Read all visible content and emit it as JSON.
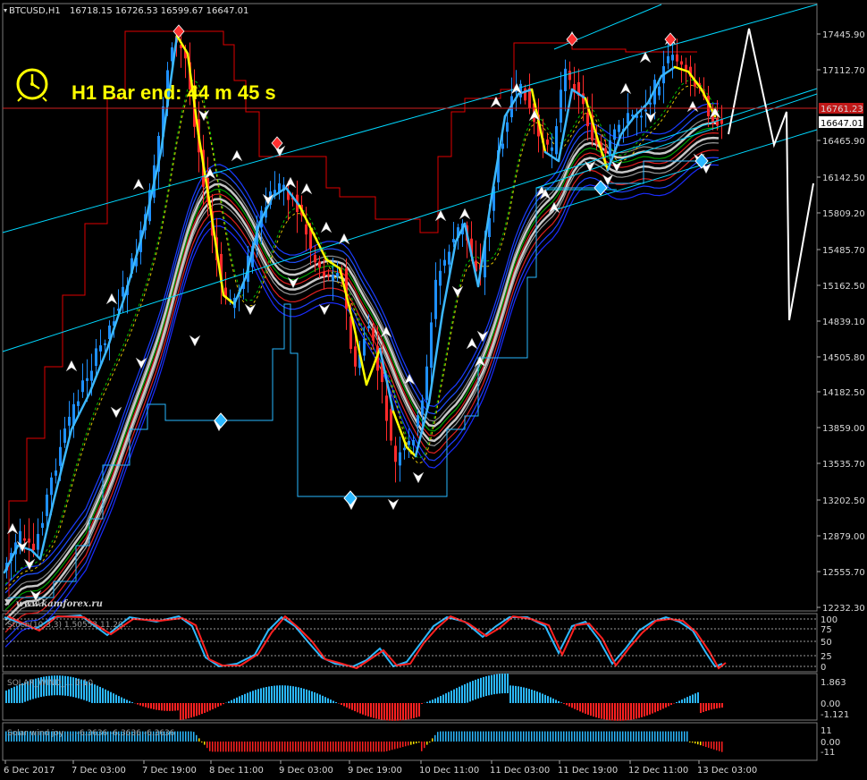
{
  "header": {
    "symbol": "BTCUSD,H1",
    "ohlc": "16718.15 16726.53 16599.67 16647.01"
  },
  "timer_label": "H1 Bar end: 44 m 45 s",
  "watermark": "www.kamforex.ru",
  "price_axis": {
    "ticks": [
      "17445.90",
      "17112.70",
      "16465.90",
      "16142.50",
      "15809.20",
      "15485.70",
      "15162.50",
      "14839.10",
      "14505.80",
      "14182.50",
      "13859.00",
      "13535.70",
      "13202.50",
      "12879.00",
      "12555.70",
      "12232.30"
    ],
    "tick_values": [
      17445.9,
      17112.7,
      16465.9,
      16142.5,
      15809.2,
      15485.7,
      15162.5,
      14839.1,
      14505.8,
      14182.5,
      13859.0,
      13535.7,
      13202.5,
      12879.0,
      12555.7,
      12232.3
    ],
    "current_price": "16647.01",
    "line_price": "16761.23",
    "line_price_value": 16761.23
  },
  "time_axis": [
    "6 Dec 2017",
    "7 Dec 03:00",
    "7 Dec 19:00",
    "8 Dec 11:00",
    "9 Dec 03:00",
    "9 Dec 19:00",
    "10 Dec 11:00",
    "11 Dec 03:00",
    "11 Dec 19:00",
    "12 Dec 11:00",
    "13 Dec 03:00"
  ],
  "stoch_panel": {
    "label": "Stoch(10,3,3) 1.50553 11.20...",
    "levels": [
      "100",
      "75",
      "50",
      "25",
      "0"
    ]
  },
  "solar_panel": {
    "label": "SOLAR_WIND_... 0.10",
    "levels": [
      "1.863",
      "0.00",
      "-1.121"
    ]
  },
  "solarjoy_panel": {
    "label": "Solar wind joy ... -6.3636 -6.3636 -6.3636",
    "levels": [
      "11",
      "0.00",
      "-11"
    ]
  },
  "colors": {
    "bull": "#1e90ff",
    "bear": "#ff2a2a",
    "trendline": "#00d8ff",
    "channel_upper": "#e00000",
    "channel_lower": "#28b8ff",
    "zigzag_yellow": "#ffff00",
    "zigzag_blue": "#3cb8ff",
    "forecast": "#ffffff"
  }
}
